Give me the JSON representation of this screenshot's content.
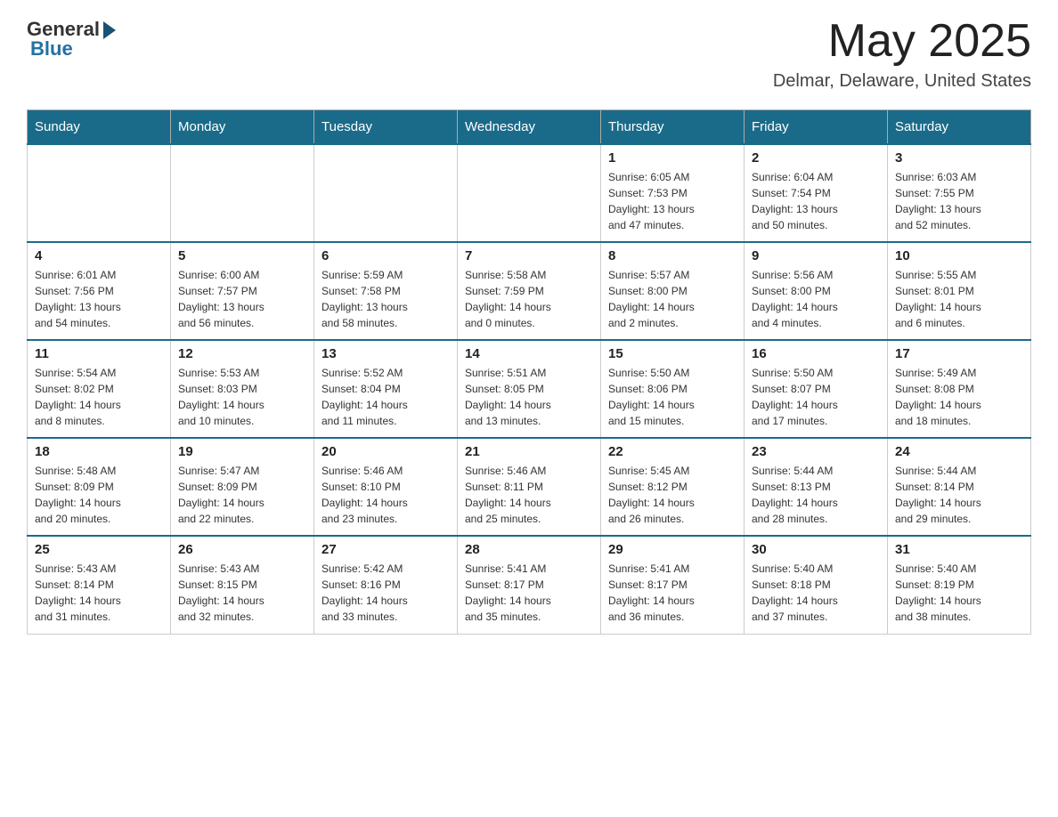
{
  "header": {
    "logo_general": "General",
    "logo_blue": "Blue",
    "month": "May 2025",
    "location": "Delmar, Delaware, United States"
  },
  "weekdays": [
    "Sunday",
    "Monday",
    "Tuesday",
    "Wednesday",
    "Thursday",
    "Friday",
    "Saturday"
  ],
  "weeks": [
    [
      {
        "day": "",
        "info": ""
      },
      {
        "day": "",
        "info": ""
      },
      {
        "day": "",
        "info": ""
      },
      {
        "day": "",
        "info": ""
      },
      {
        "day": "1",
        "info": "Sunrise: 6:05 AM\nSunset: 7:53 PM\nDaylight: 13 hours\nand 47 minutes."
      },
      {
        "day": "2",
        "info": "Sunrise: 6:04 AM\nSunset: 7:54 PM\nDaylight: 13 hours\nand 50 minutes."
      },
      {
        "day": "3",
        "info": "Sunrise: 6:03 AM\nSunset: 7:55 PM\nDaylight: 13 hours\nand 52 minutes."
      }
    ],
    [
      {
        "day": "4",
        "info": "Sunrise: 6:01 AM\nSunset: 7:56 PM\nDaylight: 13 hours\nand 54 minutes."
      },
      {
        "day": "5",
        "info": "Sunrise: 6:00 AM\nSunset: 7:57 PM\nDaylight: 13 hours\nand 56 minutes."
      },
      {
        "day": "6",
        "info": "Sunrise: 5:59 AM\nSunset: 7:58 PM\nDaylight: 13 hours\nand 58 minutes."
      },
      {
        "day": "7",
        "info": "Sunrise: 5:58 AM\nSunset: 7:59 PM\nDaylight: 14 hours\nand 0 minutes."
      },
      {
        "day": "8",
        "info": "Sunrise: 5:57 AM\nSunset: 8:00 PM\nDaylight: 14 hours\nand 2 minutes."
      },
      {
        "day": "9",
        "info": "Sunrise: 5:56 AM\nSunset: 8:00 PM\nDaylight: 14 hours\nand 4 minutes."
      },
      {
        "day": "10",
        "info": "Sunrise: 5:55 AM\nSunset: 8:01 PM\nDaylight: 14 hours\nand 6 minutes."
      }
    ],
    [
      {
        "day": "11",
        "info": "Sunrise: 5:54 AM\nSunset: 8:02 PM\nDaylight: 14 hours\nand 8 minutes."
      },
      {
        "day": "12",
        "info": "Sunrise: 5:53 AM\nSunset: 8:03 PM\nDaylight: 14 hours\nand 10 minutes."
      },
      {
        "day": "13",
        "info": "Sunrise: 5:52 AM\nSunset: 8:04 PM\nDaylight: 14 hours\nand 11 minutes."
      },
      {
        "day": "14",
        "info": "Sunrise: 5:51 AM\nSunset: 8:05 PM\nDaylight: 14 hours\nand 13 minutes."
      },
      {
        "day": "15",
        "info": "Sunrise: 5:50 AM\nSunset: 8:06 PM\nDaylight: 14 hours\nand 15 minutes."
      },
      {
        "day": "16",
        "info": "Sunrise: 5:50 AM\nSunset: 8:07 PM\nDaylight: 14 hours\nand 17 minutes."
      },
      {
        "day": "17",
        "info": "Sunrise: 5:49 AM\nSunset: 8:08 PM\nDaylight: 14 hours\nand 18 minutes."
      }
    ],
    [
      {
        "day": "18",
        "info": "Sunrise: 5:48 AM\nSunset: 8:09 PM\nDaylight: 14 hours\nand 20 minutes."
      },
      {
        "day": "19",
        "info": "Sunrise: 5:47 AM\nSunset: 8:09 PM\nDaylight: 14 hours\nand 22 minutes."
      },
      {
        "day": "20",
        "info": "Sunrise: 5:46 AM\nSunset: 8:10 PM\nDaylight: 14 hours\nand 23 minutes."
      },
      {
        "day": "21",
        "info": "Sunrise: 5:46 AM\nSunset: 8:11 PM\nDaylight: 14 hours\nand 25 minutes."
      },
      {
        "day": "22",
        "info": "Sunrise: 5:45 AM\nSunset: 8:12 PM\nDaylight: 14 hours\nand 26 minutes."
      },
      {
        "day": "23",
        "info": "Sunrise: 5:44 AM\nSunset: 8:13 PM\nDaylight: 14 hours\nand 28 minutes."
      },
      {
        "day": "24",
        "info": "Sunrise: 5:44 AM\nSunset: 8:14 PM\nDaylight: 14 hours\nand 29 minutes."
      }
    ],
    [
      {
        "day": "25",
        "info": "Sunrise: 5:43 AM\nSunset: 8:14 PM\nDaylight: 14 hours\nand 31 minutes."
      },
      {
        "day": "26",
        "info": "Sunrise: 5:43 AM\nSunset: 8:15 PM\nDaylight: 14 hours\nand 32 minutes."
      },
      {
        "day": "27",
        "info": "Sunrise: 5:42 AM\nSunset: 8:16 PM\nDaylight: 14 hours\nand 33 minutes."
      },
      {
        "day": "28",
        "info": "Sunrise: 5:41 AM\nSunset: 8:17 PM\nDaylight: 14 hours\nand 35 minutes."
      },
      {
        "day": "29",
        "info": "Sunrise: 5:41 AM\nSunset: 8:17 PM\nDaylight: 14 hours\nand 36 minutes."
      },
      {
        "day": "30",
        "info": "Sunrise: 5:40 AM\nSunset: 8:18 PM\nDaylight: 14 hours\nand 37 minutes."
      },
      {
        "day": "31",
        "info": "Sunrise: 5:40 AM\nSunset: 8:19 PM\nDaylight: 14 hours\nand 38 minutes."
      }
    ]
  ]
}
